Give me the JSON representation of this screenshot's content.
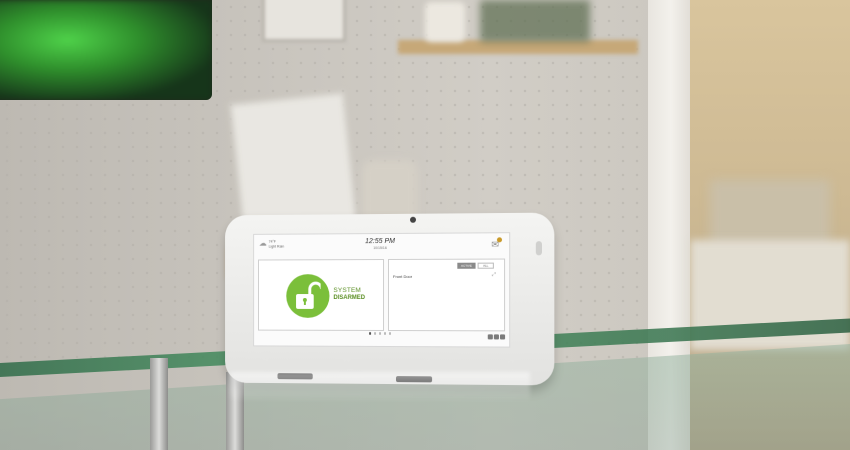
{
  "screen": {
    "weather": {
      "icon": "cloud-sun-icon",
      "temperature": "74°F",
      "condition": "Light Rain"
    },
    "clock": {
      "time": "12:55 PM",
      "date": "10/15/16"
    },
    "mail_icon": "envelope-icon",
    "security": {
      "status_line1": "SYSTEM",
      "status_line2": "DISARMED",
      "lock_icon": "unlocked-padlock-icon",
      "color": "#7bbf3a"
    },
    "sensors": {
      "tab_active": "ACTIVE",
      "tab_all": "ALL",
      "items": [
        {
          "name": "Front Door",
          "icon": "door-icon"
        }
      ]
    },
    "page_indicator": {
      "count": 5,
      "active": 0
    }
  }
}
